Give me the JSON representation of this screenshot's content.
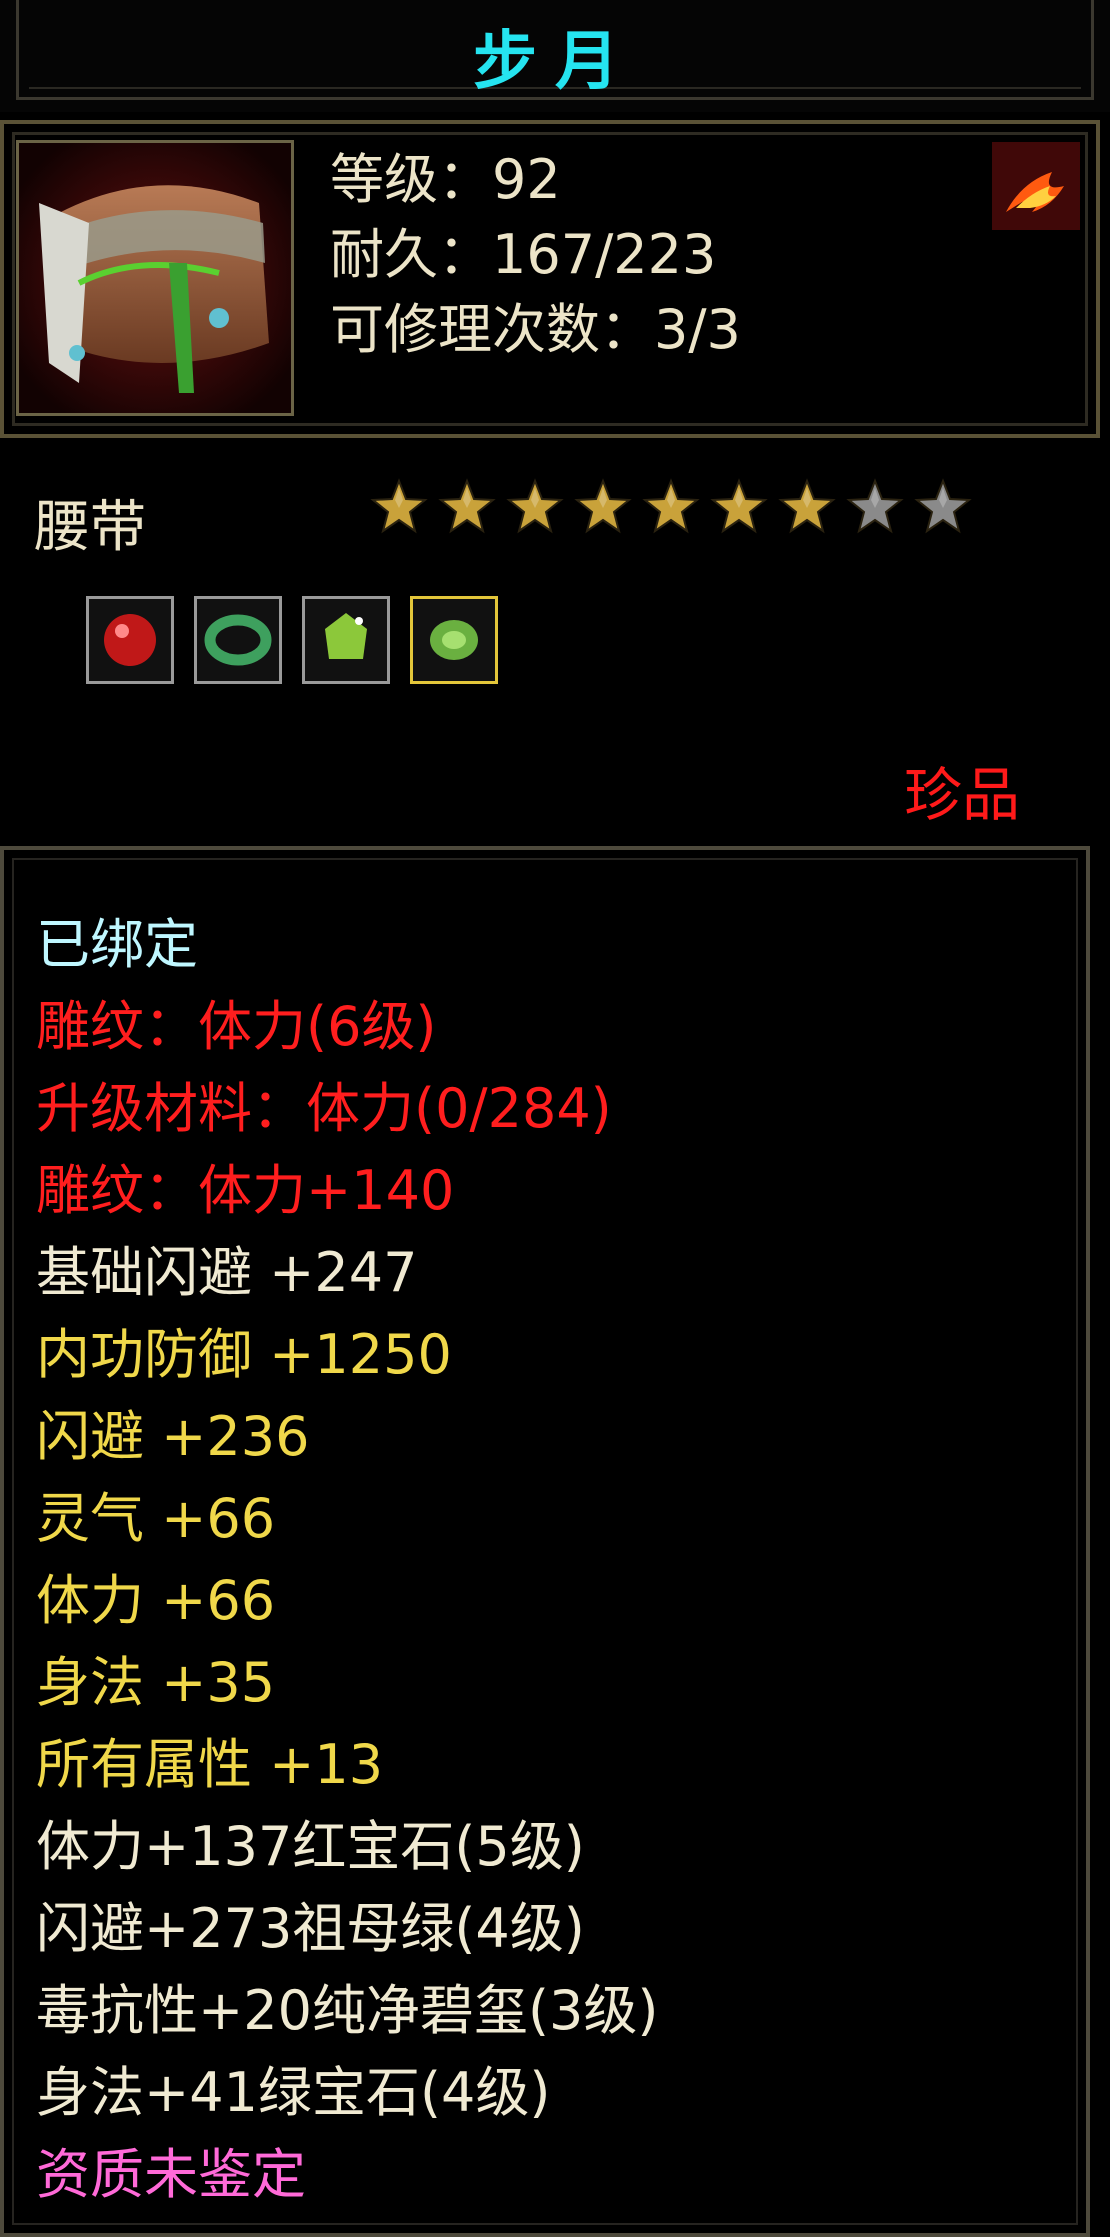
{
  "title": "步月",
  "item": {
    "icon": "belt-icon",
    "level_line": "等级：92",
    "durability_line": "耐久：167/223",
    "repair_line": "可修理次数：3/3",
    "class_icon": "flame-icon"
  },
  "slot": "腰带",
  "stars": {
    "filled": 7,
    "total": 9,
    "colors": {
      "filled": "#c9a23a",
      "empty": "#8a8a8a"
    }
  },
  "gems": [
    {
      "icon": "red-gem-icon",
      "color": "#d42020"
    },
    {
      "icon": "jade-ring-icon",
      "color": "#3fa060"
    },
    {
      "icon": "green-gem-icon",
      "color": "#8ac030"
    },
    {
      "icon": "green-jade-icon",
      "color": "#6ab040",
      "selected": true
    }
  ],
  "rarity": "珍品",
  "attributes": [
    {
      "text": "已绑定",
      "color": "cyan"
    },
    {
      "text": "雕纹：体力(6级)",
      "color": "red"
    },
    {
      "text": "升级材料：体力(0/284)",
      "color": "red"
    },
    {
      "text": "雕纹：体力+140",
      "color": "red"
    },
    {
      "text": "基础闪避 +247",
      "color": "white"
    },
    {
      "text": "内功防御 +1250",
      "color": "yellow"
    },
    {
      "text": "闪避 +236",
      "color": "yellow"
    },
    {
      "text": "灵气 +66",
      "color": "yellow"
    },
    {
      "text": "体力 +66",
      "color": "yellow"
    },
    {
      "text": "身法 +35",
      "color": "yellow"
    },
    {
      "text": "所有属性 +13",
      "color": "yellow"
    },
    {
      "text": "体力+137红宝石(5级)",
      "color": "white"
    },
    {
      "text": "闪避+273祖母绿(4级)",
      "color": "white"
    },
    {
      "text": "毒抗性+20纯净碧玺(3级)",
      "color": "white"
    },
    {
      "text": "身法+41绿宝石(4级)",
      "color": "white"
    },
    {
      "text": "资质未鉴定",
      "color": "pink"
    }
  ]
}
